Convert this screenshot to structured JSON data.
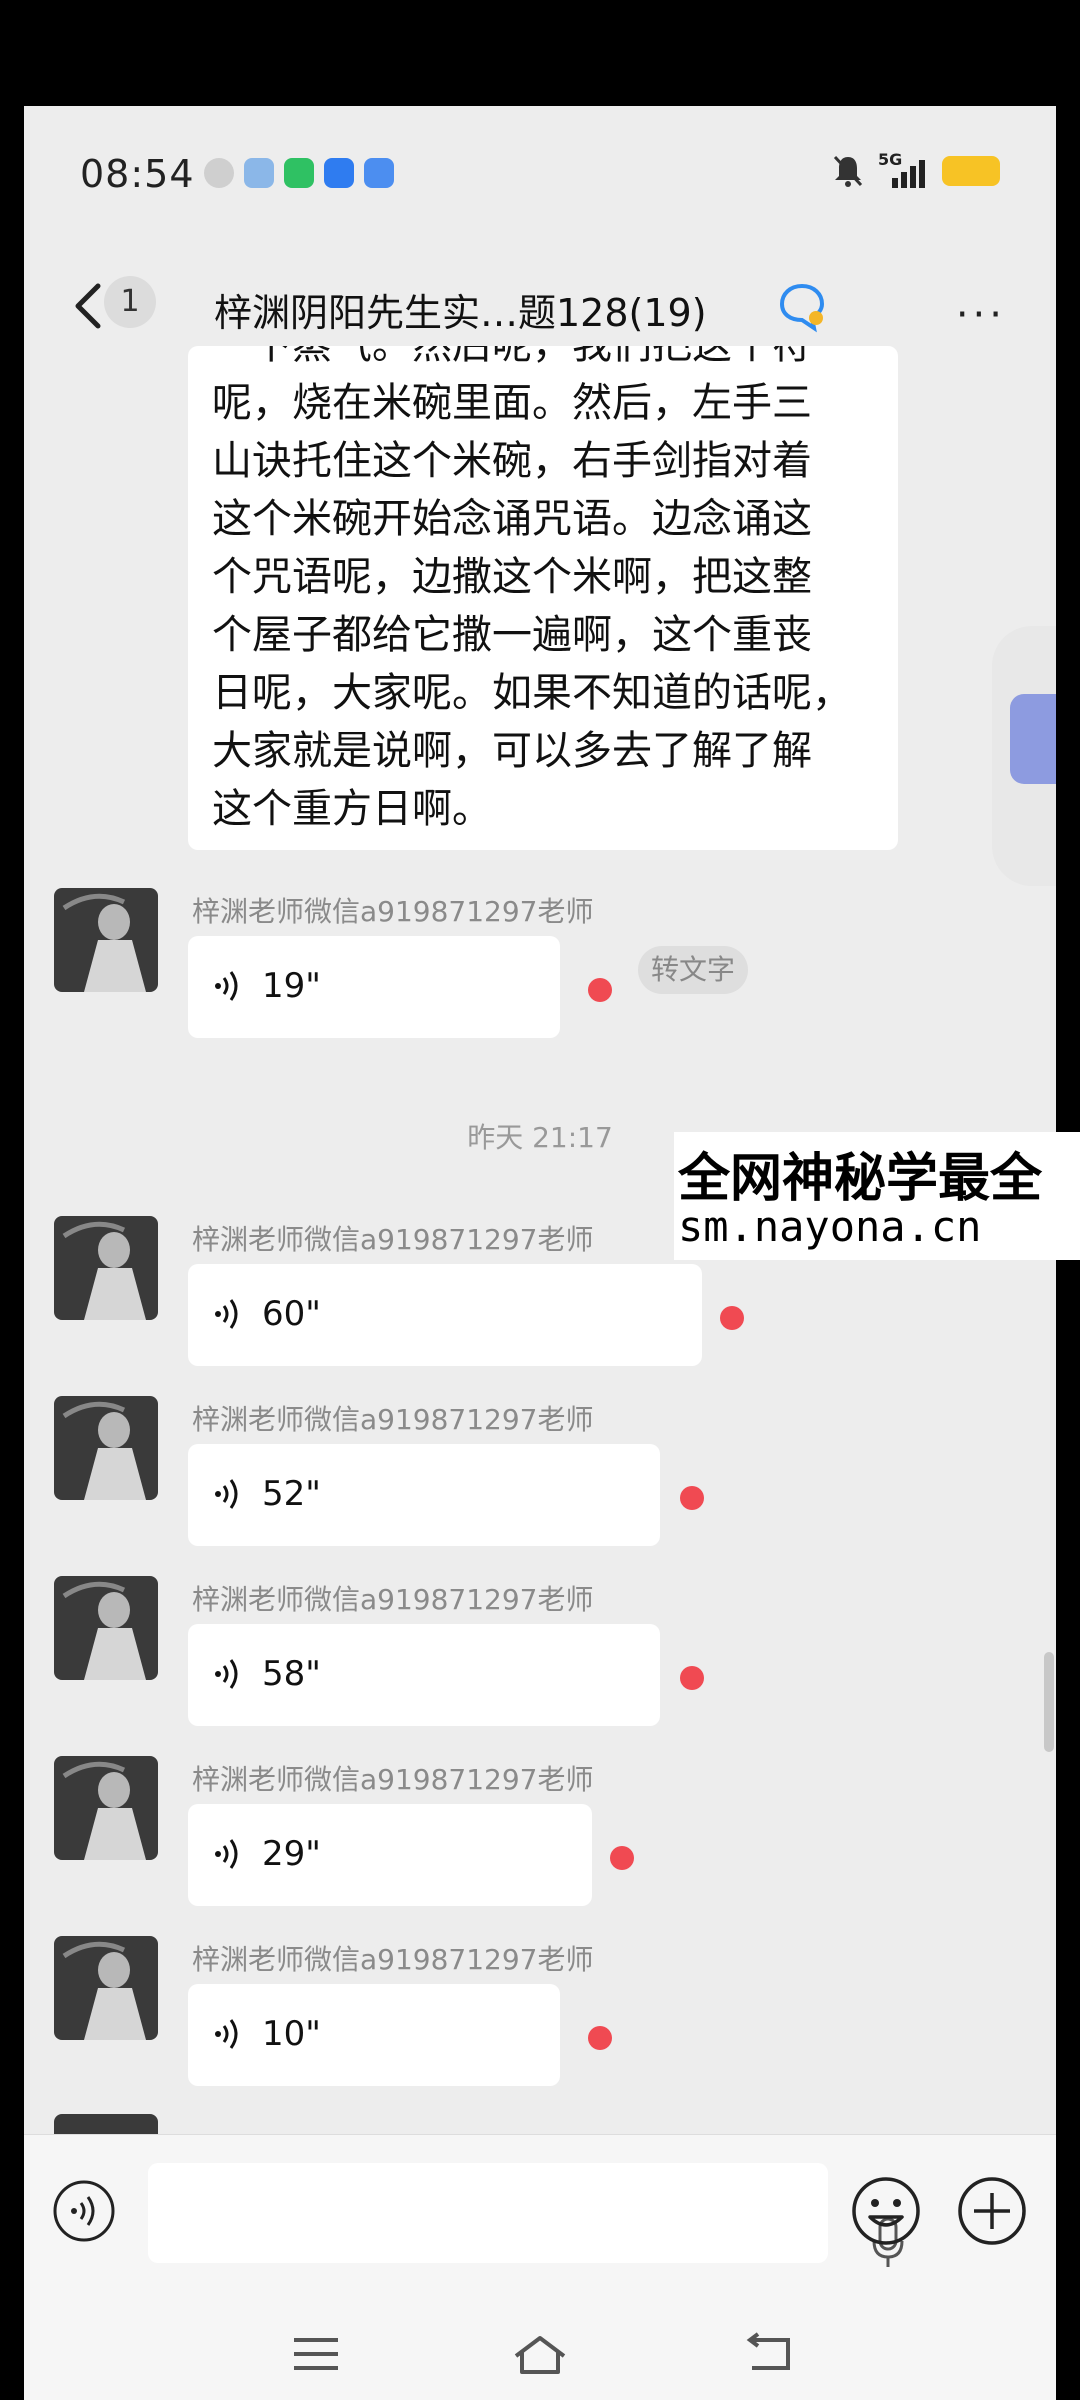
{
  "status": {
    "time": "08:54",
    "network": "5G"
  },
  "header": {
    "unread": "1",
    "title": "梓渊阴阳先生实…题128(19)",
    "more": "···"
  },
  "text_message": {
    "lines": [
      "一下蒸气。然后呢，我们把这个符",
      "呢，烧在米碗里面。然后，左手三",
      "山诀托住这个米碗，右手剑指对着",
      "这个米碗开始念诵咒语。边念诵这",
      "个咒语呢，边撒这个米啊，把这整",
      "个屋子都给它撒一遍啊，这个重丧",
      "日呢，大家呢。如果不知道的话呢，",
      "大家就是说啊，可以多去了解了解",
      "这个重方日啊。"
    ]
  },
  "messages": [
    {
      "sender": "梓渊老师微信a919871297老师",
      "duration": "19\"",
      "transcribe": "转文字"
    },
    {
      "sender": "梓渊老师微信a919871297老师",
      "duration": "60\""
    },
    {
      "sender": "梓渊老师微信a919871297老师",
      "duration": "52\""
    },
    {
      "sender": "梓渊老师微信a919871297老师",
      "duration": "58\""
    },
    {
      "sender": "梓渊老师微信a919871297老师",
      "duration": "29\""
    },
    {
      "sender": "梓渊老师微信a919871297老师",
      "duration": "10\""
    }
  ],
  "timestamp": "昨天 21:17",
  "watermark": {
    "line1": "全网神秘学最全",
    "line2": "sm.nayona.cn"
  },
  "colors": {
    "unread_dot": "#f04a52",
    "background": "#ededed",
    "bubble": "#ffffff"
  }
}
